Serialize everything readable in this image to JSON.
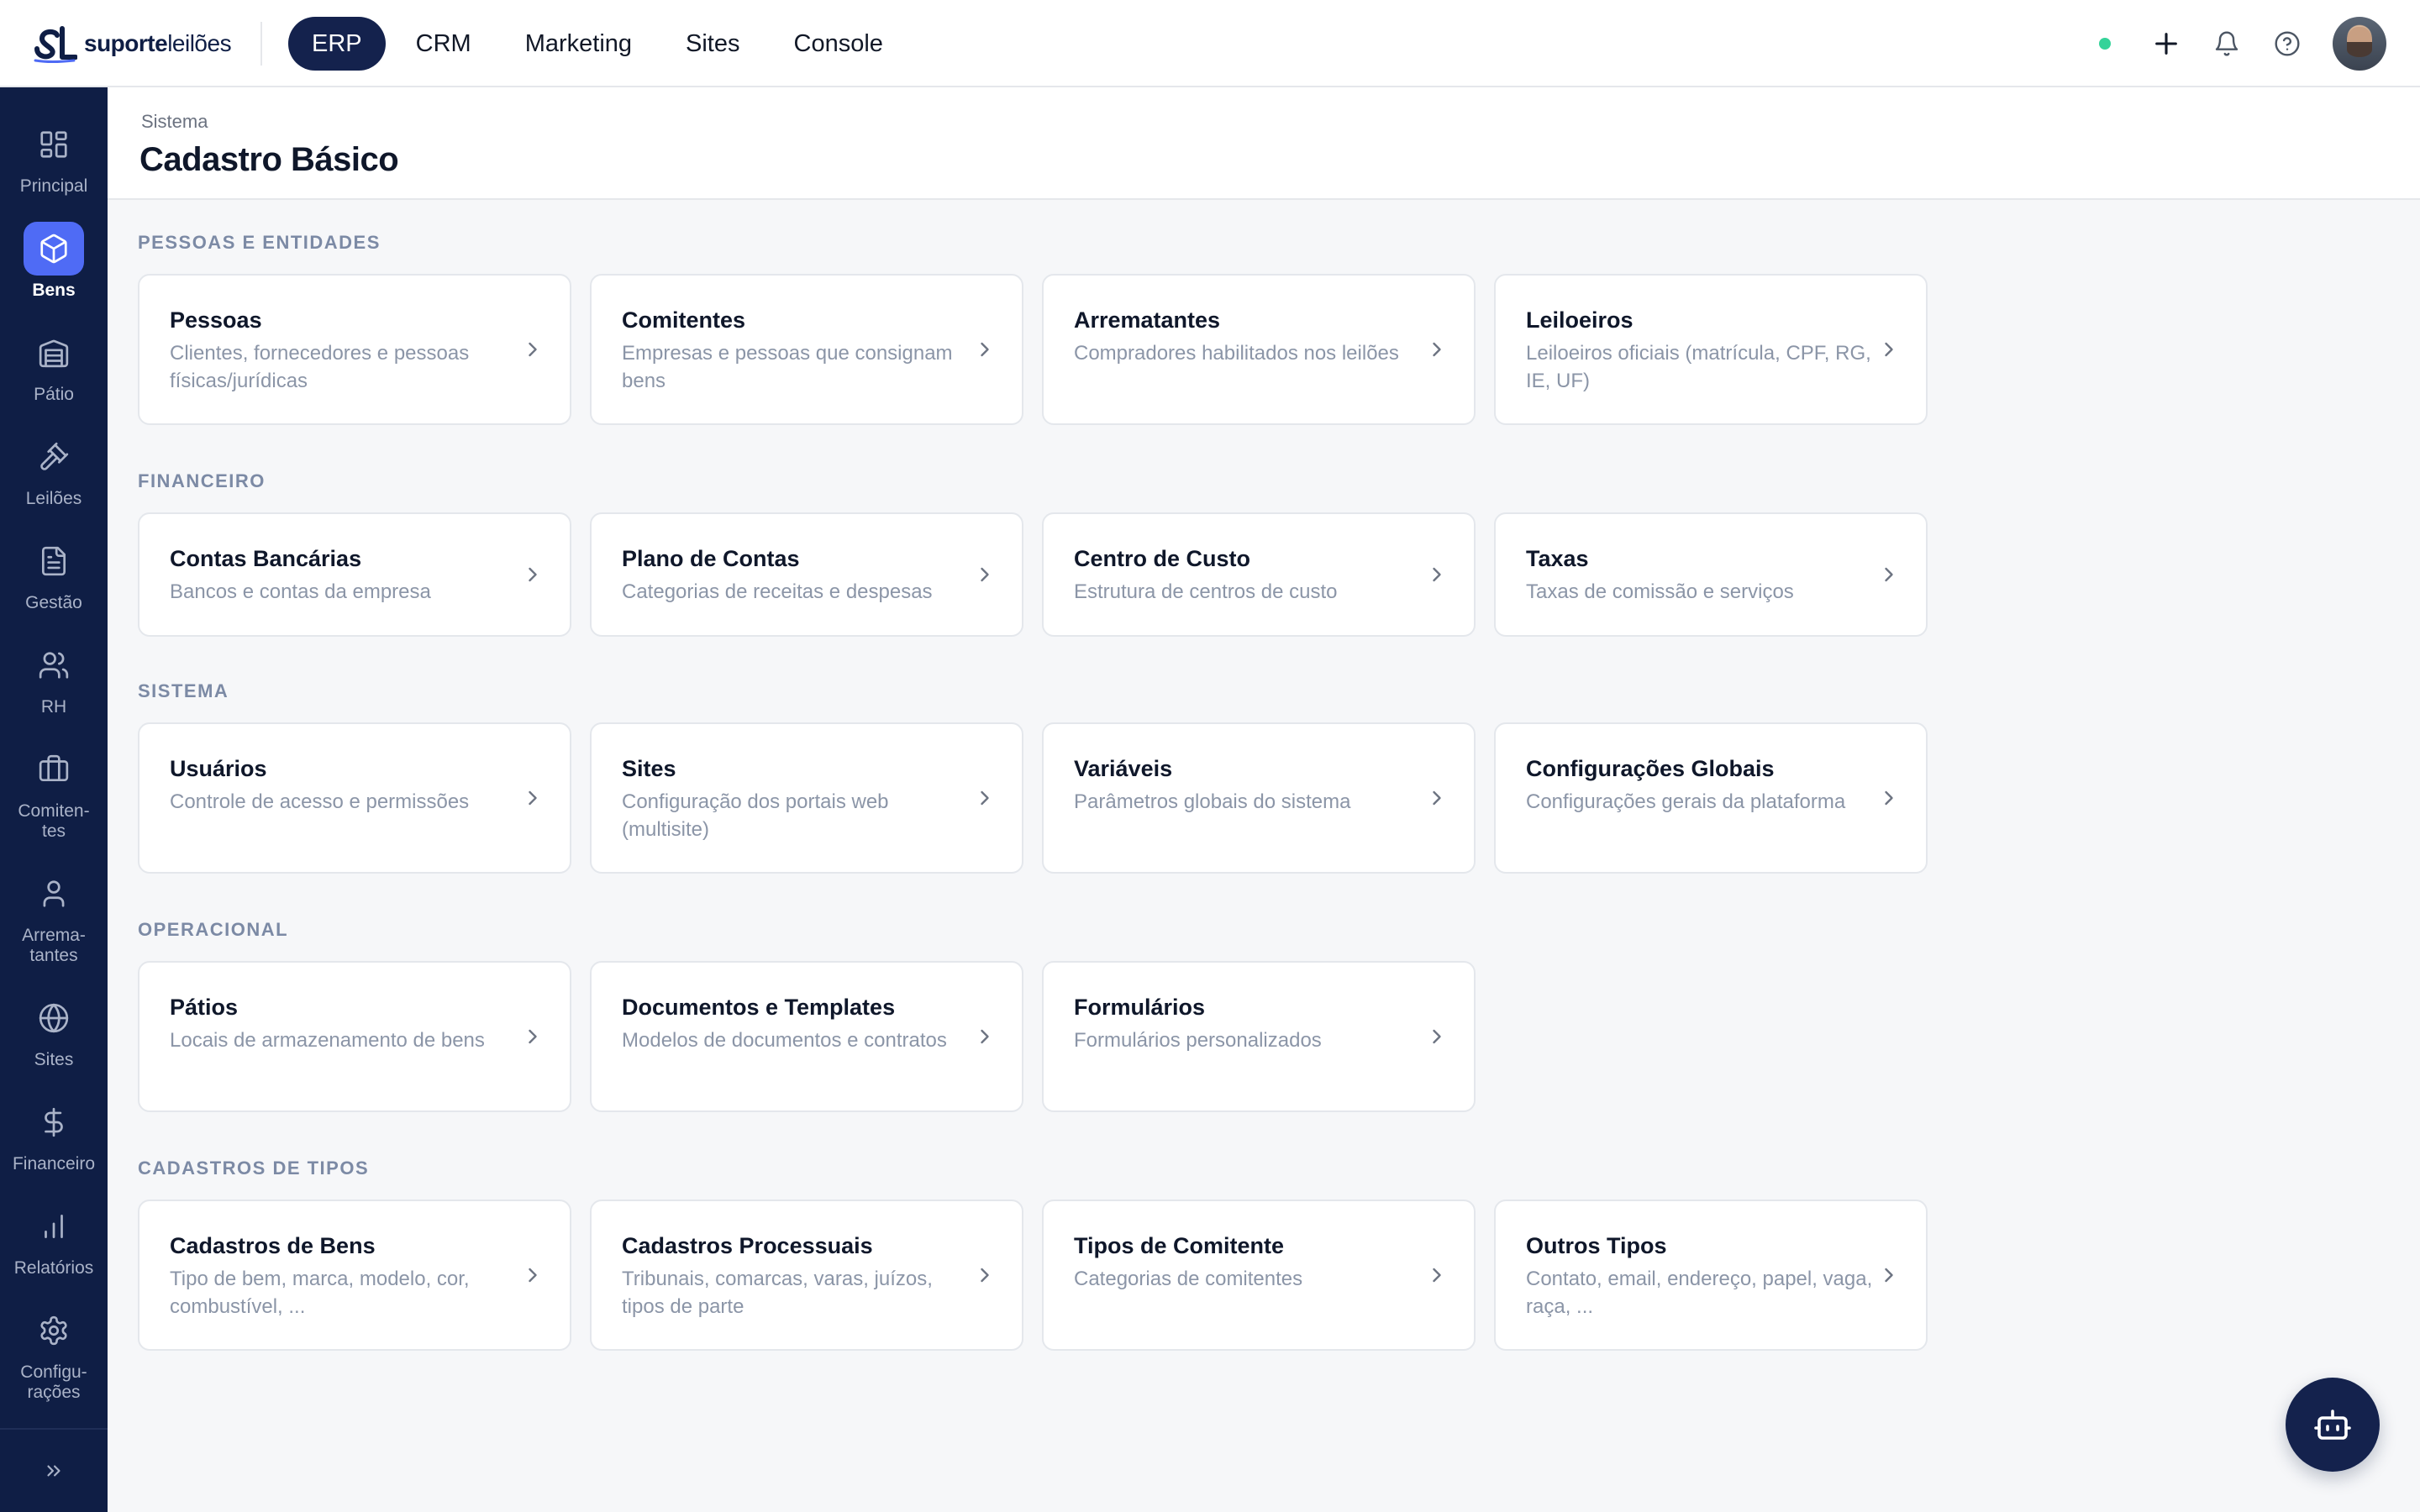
{
  "brand": {
    "name_bold": "suporte",
    "name_light": "leilões",
    "mark": "SL"
  },
  "topnav": [
    {
      "label": "ERP",
      "active": true
    },
    {
      "label": "CRM",
      "active": false
    },
    {
      "label": "Marketing",
      "active": false
    },
    {
      "label": "Sites",
      "active": false
    },
    {
      "label": "Console",
      "active": false
    }
  ],
  "topbar_icons": [
    "plus-icon",
    "bell-icon",
    "help-icon"
  ],
  "sidebar": [
    {
      "label": "Principal",
      "icon": "grid-icon",
      "active": false
    },
    {
      "label": "Bens",
      "icon": "box-icon",
      "active": true
    },
    {
      "label": "Pátio",
      "icon": "building-icon",
      "active": false
    },
    {
      "label": "Leilões",
      "icon": "gavel-icon",
      "active": false
    },
    {
      "label": "Gestão",
      "icon": "document-icon",
      "active": false
    },
    {
      "label": "RH",
      "icon": "users-icon",
      "active": false
    },
    {
      "label": "Comiten-\ntes",
      "icon": "briefcase-icon",
      "active": false
    },
    {
      "label": "Arrema-\ntantes",
      "icon": "user-icon",
      "active": false
    },
    {
      "label": "Sites",
      "icon": "globe-icon",
      "active": false
    },
    {
      "label": "Financeiro",
      "icon": "dollar-icon",
      "active": false
    },
    {
      "label": "Relatórios",
      "icon": "bar-chart-icon",
      "active": false
    },
    {
      "label": "Configu-\nrações",
      "icon": "gear-icon",
      "active": false
    }
  ],
  "header": {
    "breadcrumb": "Sistema",
    "title": "Cadastro Básico"
  },
  "sections": [
    {
      "title": "PESSOAS E ENTIDADES",
      "cards": [
        {
          "title": "Pessoas",
          "desc": "Clientes, fornecedores e pessoas físicas/jurídicas"
        },
        {
          "title": "Comitentes",
          "desc": "Empresas e pessoas que consignam bens"
        },
        {
          "title": "Arrematantes",
          "desc": "Compradores habilitados nos leilões"
        },
        {
          "title": "Leiloeiros",
          "desc": "Leiloeiros oficiais (matrícula, CPF, RG, IE, UF)"
        }
      ]
    },
    {
      "title": "FINANCEIRO",
      "cards": [
        {
          "title": "Contas Bancárias",
          "desc": "Bancos e contas da empresa"
        },
        {
          "title": "Plano de Contas",
          "desc": "Categorias de receitas e despesas"
        },
        {
          "title": "Centro de Custo",
          "desc": "Estrutura de centros de custo"
        },
        {
          "title": "Taxas",
          "desc": "Taxas de comissão e serviços"
        }
      ]
    },
    {
      "title": "SISTEMA",
      "cards": [
        {
          "title": "Usuários",
          "desc": "Controle de acesso e permissões"
        },
        {
          "title": "Sites",
          "desc": "Configuração dos portais web (multisite)"
        },
        {
          "title": "Variáveis",
          "desc": "Parâmetros globais do sistema"
        },
        {
          "title": "Configurações Globais",
          "desc": "Configurações gerais da plataforma"
        }
      ]
    },
    {
      "title": "OPERACIONAL",
      "cards": [
        {
          "title": "Pátios",
          "desc": "Locais de armazenamento de bens"
        },
        {
          "title": "Documentos e Templates",
          "desc": "Modelos de documentos e contratos"
        },
        {
          "title": "Formulários",
          "desc": "Formulários personalizados"
        }
      ]
    },
    {
      "title": "CADASTROS DE TIPOS",
      "cards": [
        {
          "title": "Cadastros de Bens",
          "desc": "Tipo de bem, marca, modelo, cor, combustível, ..."
        },
        {
          "title": "Cadastros Processuais",
          "desc": "Tribunais, comarcas, varas, juízos, tipos de parte"
        },
        {
          "title": "Tipos de Comitente",
          "desc": "Categorias de comitentes"
        },
        {
          "title": "Outros Tipos",
          "desc": "Contato, email, endereço, papel, vaga, raça, ..."
        }
      ]
    }
  ],
  "colors": {
    "navy": "#0f1e45",
    "accent": "#4f6bf5",
    "online": "#34d399"
  }
}
